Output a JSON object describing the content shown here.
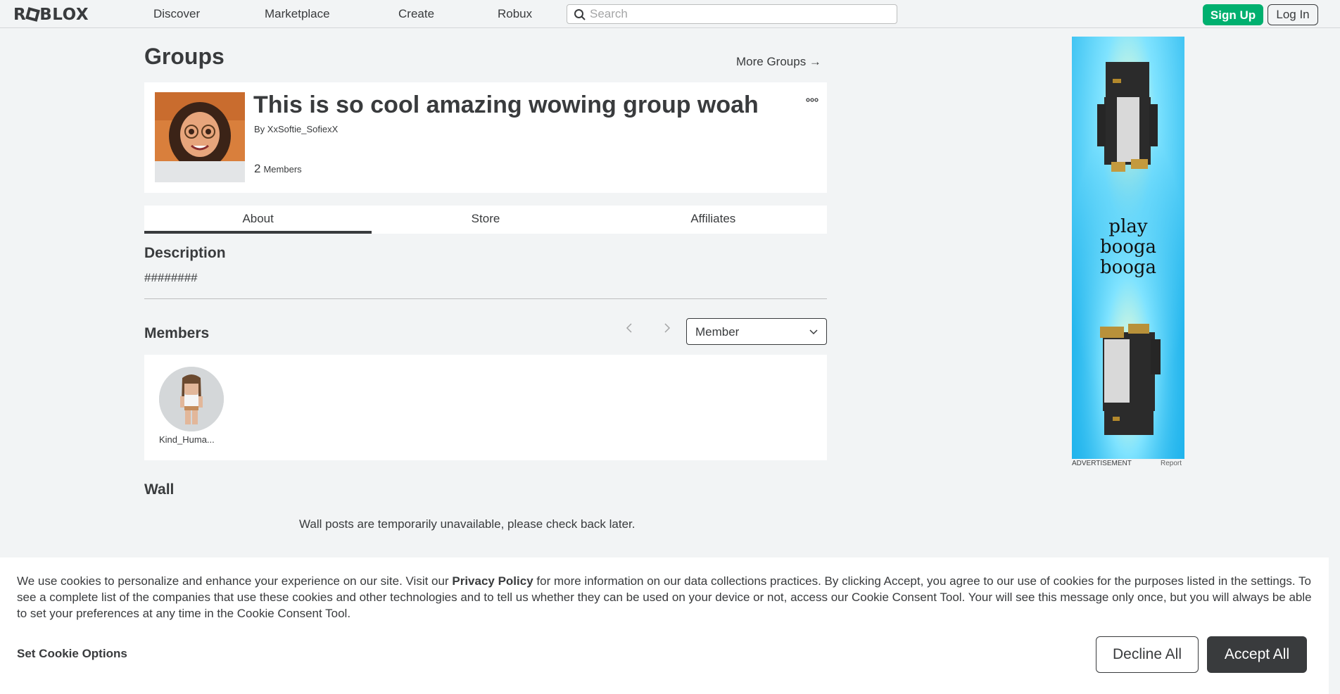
{
  "nav": {
    "logo": "ROBLOX",
    "links": [
      "Discover",
      "Marketplace",
      "Create",
      "Robux"
    ],
    "search_placeholder": "Search",
    "signup": "Sign Up",
    "login": "Log In"
  },
  "page": {
    "title": "Groups",
    "more_groups": "More Groups →"
  },
  "group": {
    "name": "This is so cool amazing wowing group woah",
    "by_prefix": "By",
    "owner": "XxSoftie_SofiexX",
    "member_count": "2",
    "member_label": "Members",
    "more_icon": "ellipsis-icon"
  },
  "tabs": [
    "About",
    "Store",
    "Affiliates"
  ],
  "active_tab": "About",
  "description": {
    "title": "Description",
    "text": "########"
  },
  "members": {
    "title": "Members",
    "role_selected": "Member",
    "list": [
      {
        "name": "Kind_Huma..."
      }
    ]
  },
  "wall": {
    "title": "Wall",
    "message": "Wall posts are temporarily unavailable, please check back later."
  },
  "ad": {
    "text_lines": [
      "play",
      "booga",
      "booga"
    ],
    "label": "ADVERTISEMENT",
    "report": "Report"
  },
  "cookie": {
    "text_before": "We use cookies to personalize and enhance your experience on our site. Visit our ",
    "privacy_link": "Privacy Policy",
    "text_after": " for more information on our data collections practices. By clicking Accept, you agree to our use of cookies for the purposes listed in the settings. To see a complete list of the companies that use these cookies and other technologies and to tell us whether they can be used on your device or not, access our Cookie Consent Tool. Your will see this message only once, but you will always be able to set your preferences at any time in the Cookie Consent Tool.",
    "set_options": "Set Cookie Options",
    "decline": "Decline All",
    "accept": "Accept All"
  },
  "colors": {
    "accent_green": "#00b06f",
    "text": "#393b3d",
    "background": "#f2f4f5"
  }
}
